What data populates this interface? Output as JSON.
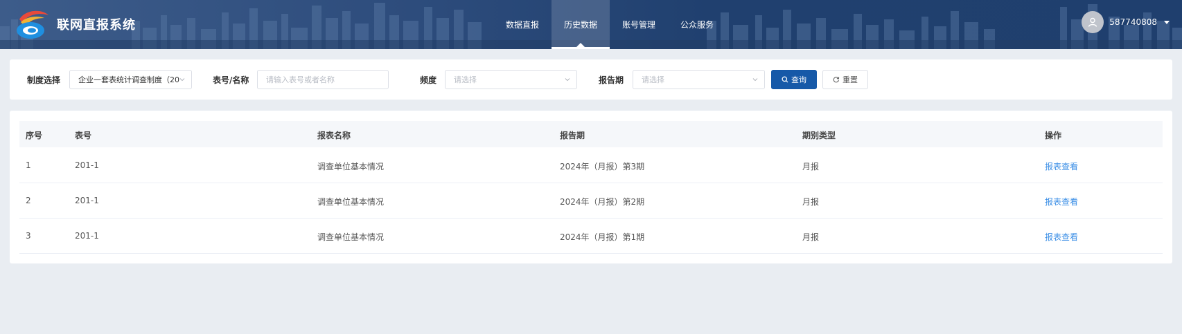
{
  "header": {
    "app_title": "联网直报系统",
    "nav": [
      "数据直报",
      "历史数据",
      "账号管理",
      "公众服务"
    ],
    "active_nav": 1,
    "user_name": "587740808"
  },
  "filter": {
    "system_label": "制度选择",
    "system_value": "企业一套表统计调查制度（20",
    "code_label": "表号/名称",
    "code_placeholder": "请输入表号或者名称",
    "freq_label": "频度",
    "freq_placeholder": "请选择",
    "period_label": "报告期",
    "period_placeholder": "请选择",
    "search_label": "查询",
    "reset_label": "重置"
  },
  "table": {
    "columns": [
      "序号",
      "表号",
      "报表名称",
      "报告期",
      "期别类型",
      "操作"
    ],
    "rows": [
      {
        "index": "1",
        "code": "201-1",
        "name": "调查单位基本情况",
        "period": "2024年（月报）第3期",
        "type": "月报",
        "action": "报表查看"
      },
      {
        "index": "2",
        "code": "201-1",
        "name": "调查单位基本情况",
        "period": "2024年（月报）第2期",
        "type": "月报",
        "action": "报表查看"
      },
      {
        "index": "3",
        "code": "201-1",
        "name": "调查单位基本情况",
        "period": "2024年（月报）第1期",
        "type": "月报",
        "action": "报表查看"
      }
    ]
  }
}
